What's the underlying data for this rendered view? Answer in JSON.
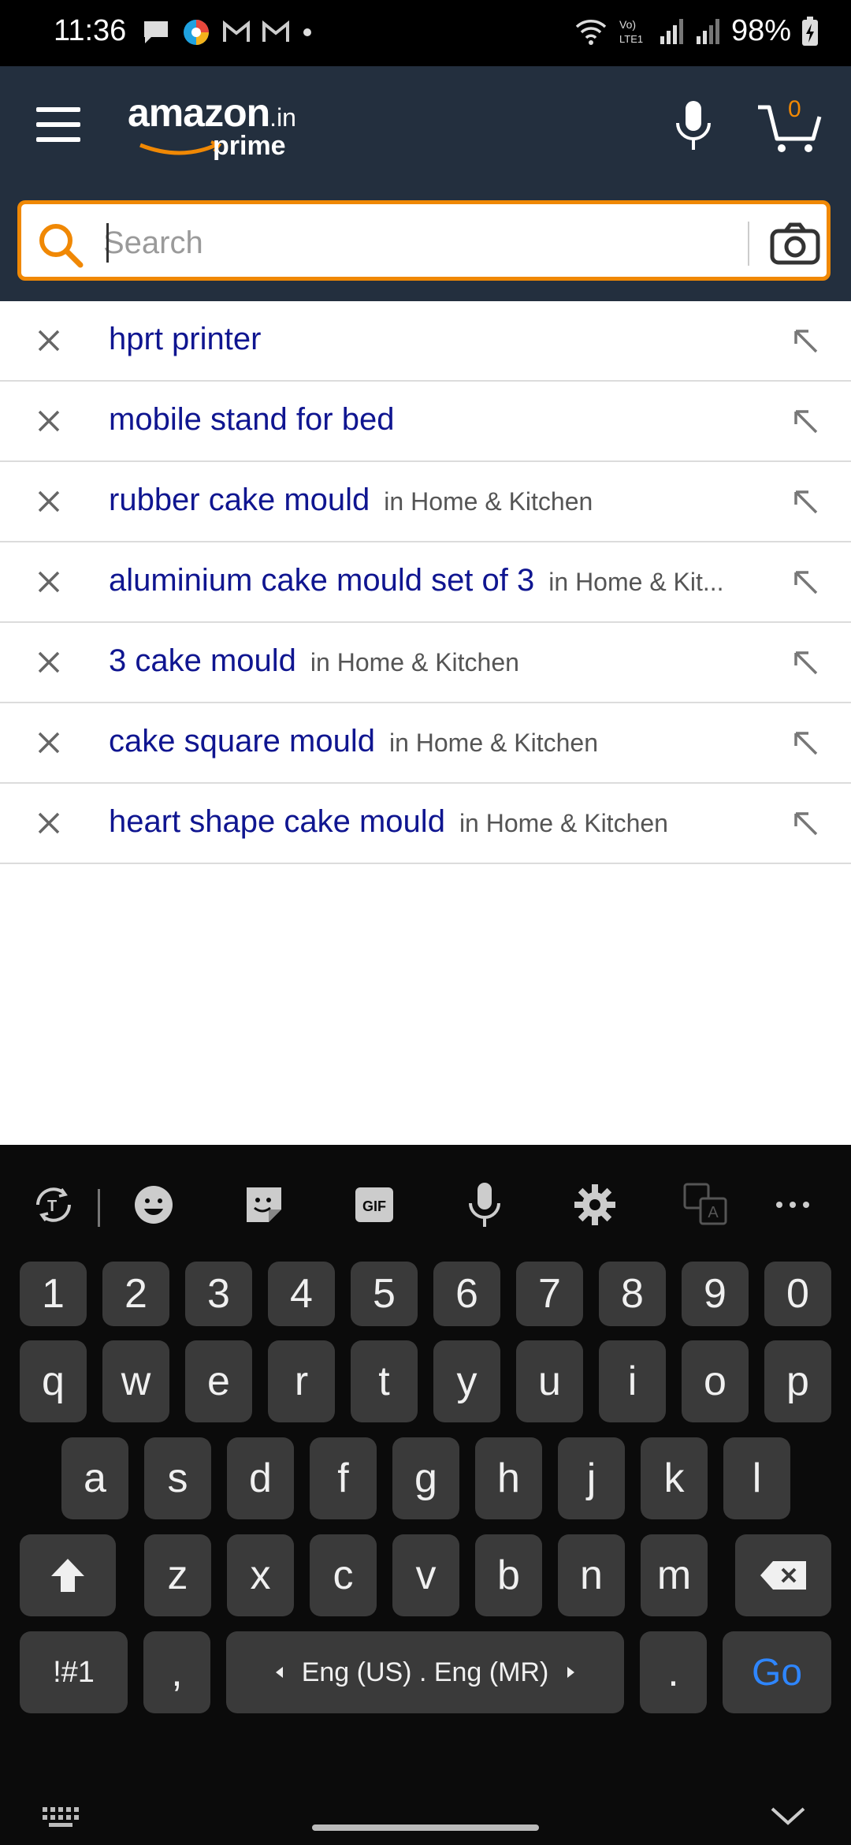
{
  "status_bar": {
    "time": "11:36",
    "battery": "98%"
  },
  "header": {
    "logo_main": "amazon",
    "logo_tld": ".in",
    "logo_sub": "prime",
    "cart_count": "0",
    "brand_color": "#232f3e",
    "accent_color": "#f08804"
  },
  "search": {
    "placeholder": "Search",
    "value": ""
  },
  "suggestions": [
    {
      "query": "hprt printer",
      "dept": ""
    },
    {
      "query": "mobile stand for bed",
      "dept": ""
    },
    {
      "query": "rubber cake mould",
      "dept": "in Home & Kitchen"
    },
    {
      "query": "aluminium cake mould set of 3",
      "dept": "in Home & Kit..."
    },
    {
      "query": "3 cake mould",
      "dept": "in Home & Kitchen"
    },
    {
      "query": "cake square mould",
      "dept": "in Home & Kitchen"
    },
    {
      "query": "heart shape cake mould",
      "dept": "in Home & Kitchen"
    }
  ],
  "keyboard": {
    "toolbar": {
      "gif": "GIF"
    },
    "row_numbers": [
      "1",
      "2",
      "3",
      "4",
      "5",
      "6",
      "7",
      "8",
      "9",
      "0"
    ],
    "row_q": [
      "q",
      "w",
      "e",
      "r",
      "t",
      "y",
      "u",
      "i",
      "o",
      "p"
    ],
    "row_a": [
      "a",
      "s",
      "d",
      "f",
      "g",
      "h",
      "j",
      "k",
      "l"
    ],
    "row_z": [
      "z",
      "x",
      "c",
      "v",
      "b",
      "n",
      "m"
    ],
    "symbols_label": "!#1",
    "comma": ",",
    "space_label": "Eng (US) . Eng (MR)",
    "period": ".",
    "go_label": "Go"
  }
}
